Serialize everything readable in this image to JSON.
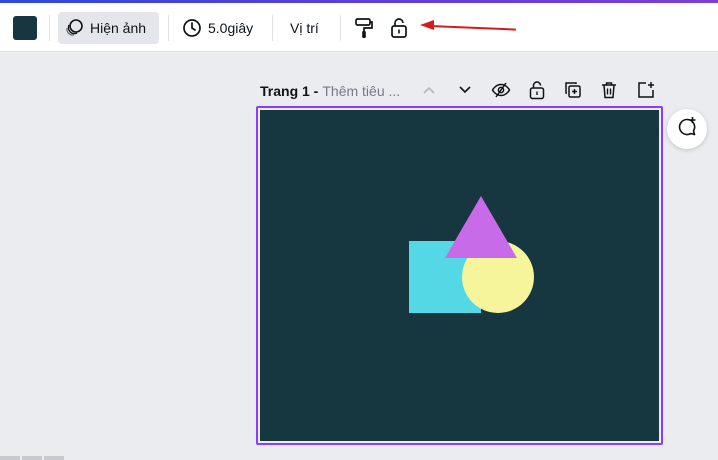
{
  "colors": {
    "accent": "#8b3dff",
    "swatch": "#163640",
    "canvas_bg": "#163640",
    "square": "#54d8e6",
    "circle": "#f7f59b",
    "triangle": "#c86be8",
    "annotation_arrow": "#d51c1c"
  },
  "toolbar": {
    "color_swatch": "color-swatch",
    "animate_label": "Hiện ảnh",
    "duration_label": "5.0giây",
    "position_label": "Vị trí",
    "icons": {
      "animate": "animate-icon",
      "timer": "timer-icon",
      "paint_format": "paint-roller-icon",
      "lock": "lock-icon"
    }
  },
  "page": {
    "title": "Trang 1 -",
    "subtitle": "Thêm tiêu ...",
    "icons": {
      "up": "chevron-up-icon",
      "down": "chevron-down-icon",
      "hide": "hide-icon",
      "lock": "lock-icon",
      "duplicate": "duplicate-icon",
      "delete": "trash-icon",
      "add": "add-page-icon"
    }
  },
  "comment": {
    "icon": "add-comment-icon"
  }
}
